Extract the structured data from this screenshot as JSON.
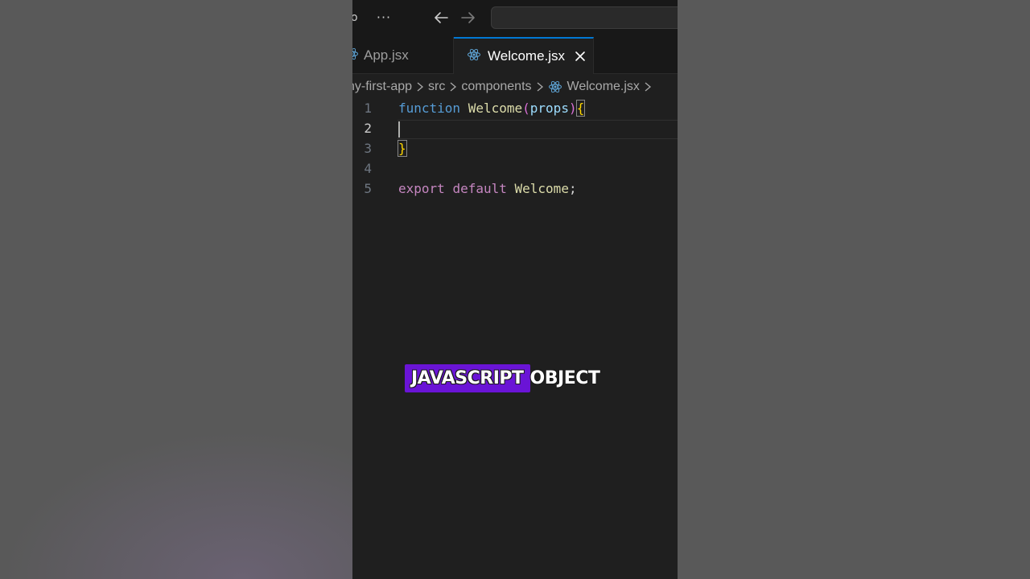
{
  "colors": {
    "accent": "#0078d4",
    "caption_highlight": "#6a14d6",
    "react_icon": "#5fa6d8"
  },
  "titlebar": {
    "more_label": "···"
  },
  "tabs": [
    {
      "label": "App.jsx",
      "icon": "react-icon",
      "active": false
    },
    {
      "label": "Welcome.jsx",
      "icon": "react-icon",
      "active": true
    }
  ],
  "breadcrumb": {
    "items": [
      "ny-first-app",
      "src",
      "components",
      "Welcome.jsx"
    ]
  },
  "editor": {
    "line_numbers": [
      "1",
      "2",
      "3",
      "4",
      "5"
    ],
    "active_line": 2,
    "line1": {
      "kw": "function",
      "name": "Welcome",
      "open_paren": "(",
      "param": "props",
      "close_paren": ")",
      "brace": "{"
    },
    "line3": {
      "brace": "}"
    },
    "line5": {
      "kw1": "export",
      "kw2": "default",
      "ident": "Welcome",
      "semi": ";"
    }
  },
  "caption": {
    "highlight": "JAVASCRIPT",
    "rest": "OBJECT"
  }
}
